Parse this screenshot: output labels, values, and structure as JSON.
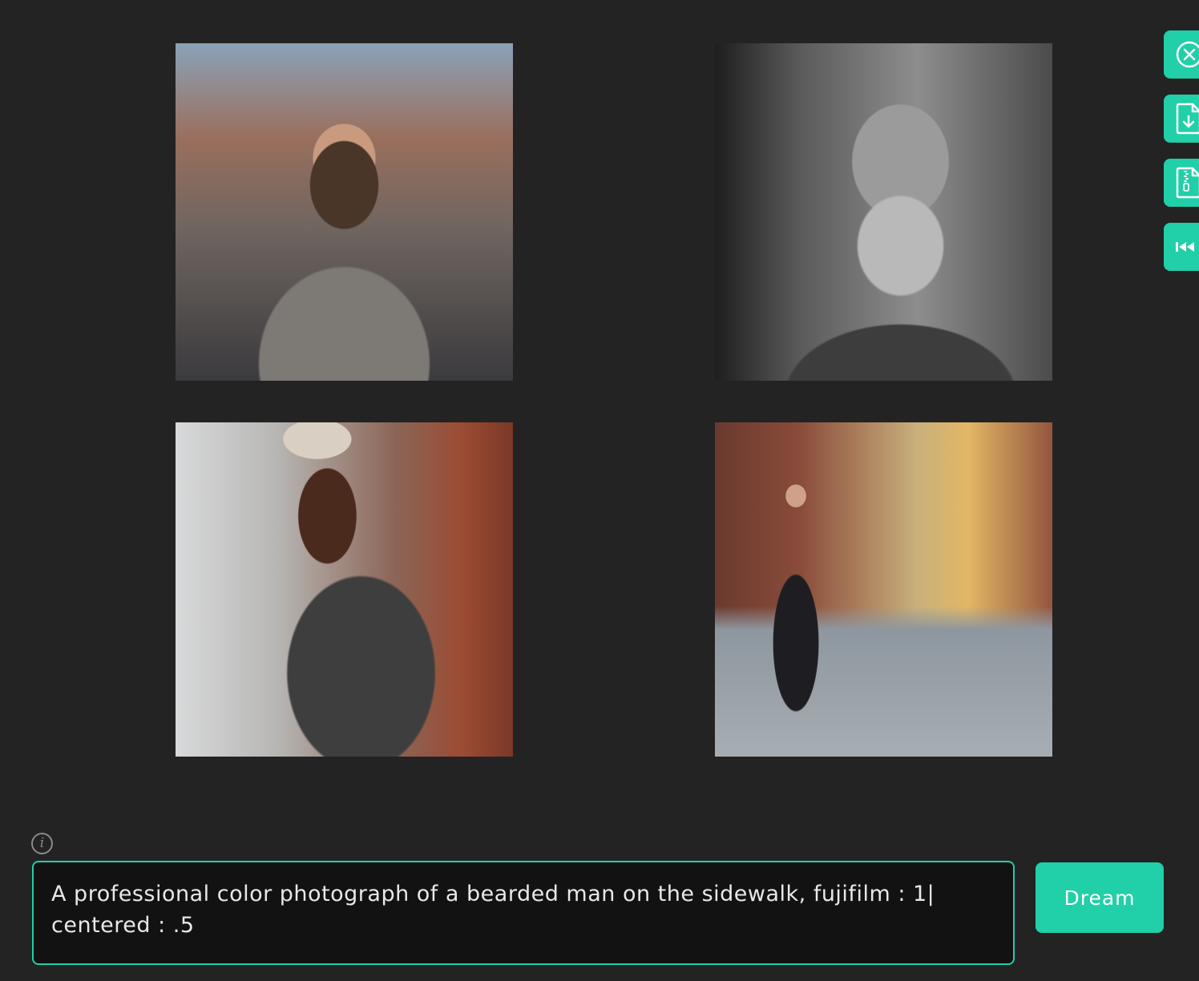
{
  "gallery": {
    "images": [
      {
        "alt": "bearded man long hair grey sweater street"
      },
      {
        "alt": "black and white bearded man grey beard jacket"
      },
      {
        "alt": "bearded man knit beanie leaning on brick wall"
      },
      {
        "alt": "bearded man black hat long coat city street"
      }
    ]
  },
  "toolbar": {
    "buttons": [
      {
        "icon": "close-circle-icon"
      },
      {
        "icon": "file-download-icon"
      },
      {
        "icon": "file-zip-icon"
      },
      {
        "icon": "rewind-icon"
      }
    ]
  },
  "info": {
    "glyph": "i"
  },
  "prompt": {
    "value": "A professional color photograph of a bearded man on the sidewalk, fujifilm : 1|\ncentered : .5"
  },
  "dream_button": {
    "label": "Dream"
  },
  "colors": {
    "accent": "#21cfa8",
    "background": "#232323",
    "input_bg": "#121212"
  }
}
